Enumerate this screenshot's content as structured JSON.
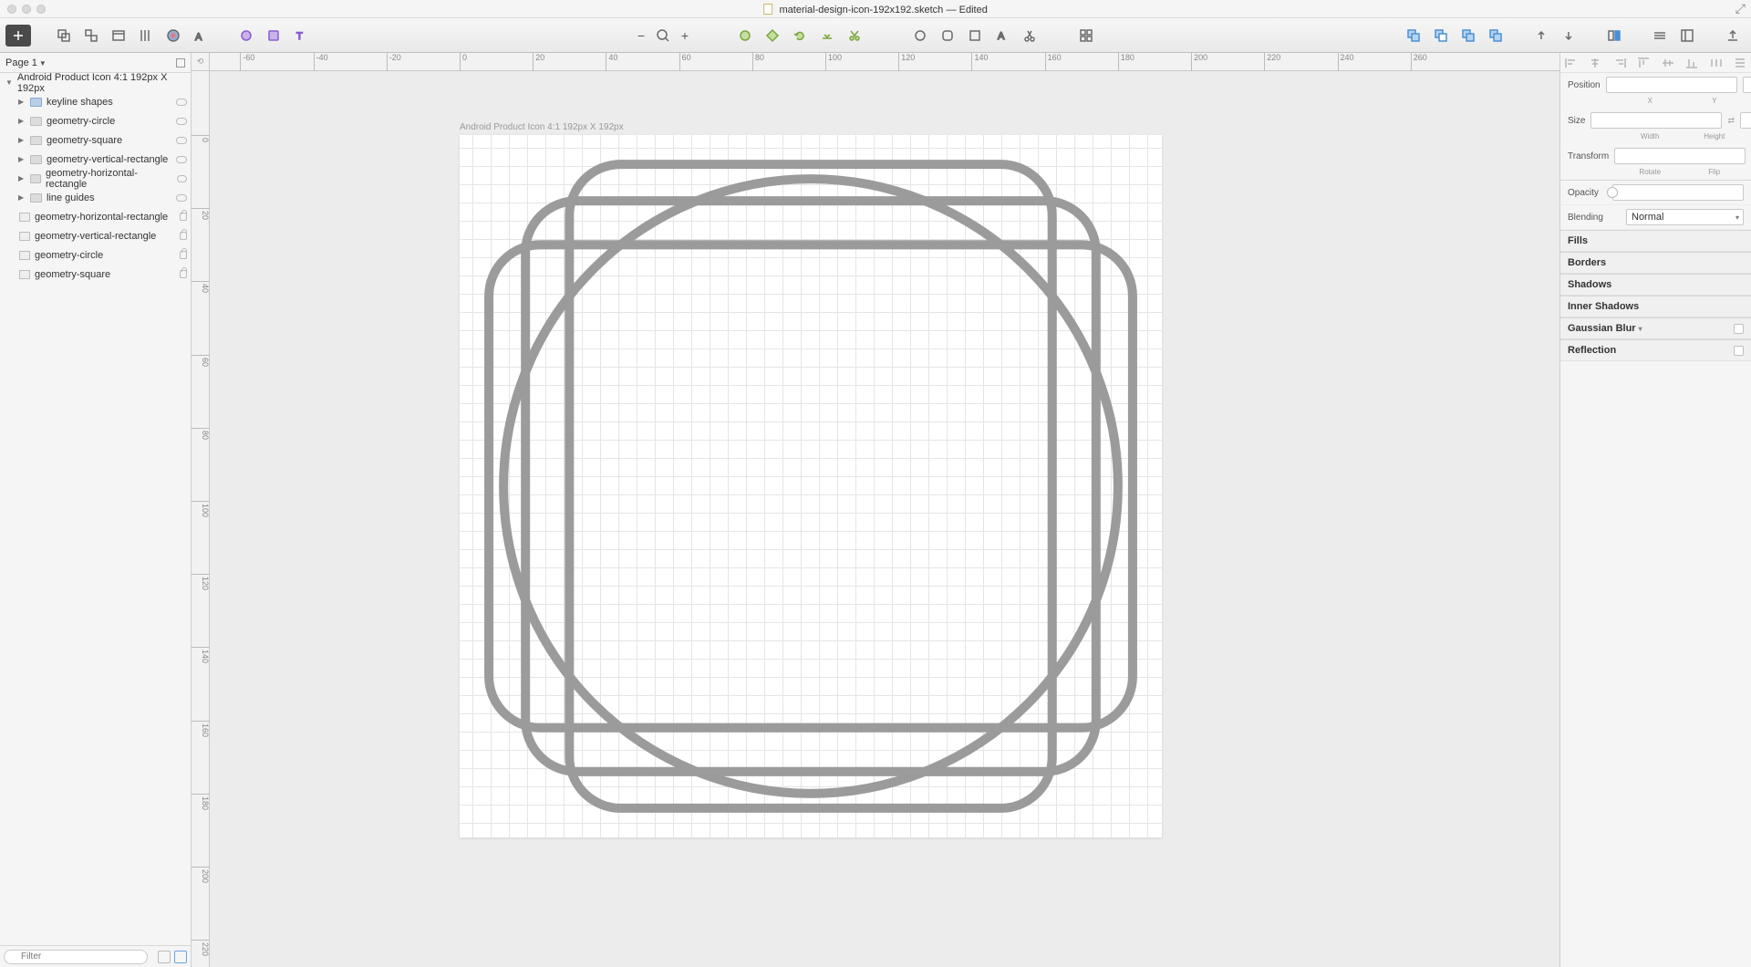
{
  "title": {
    "filename": "material-design-icon-192x192.sketch",
    "status": "— Edited"
  },
  "pages": {
    "label": "Page 1"
  },
  "layers": {
    "artboard": "Android Product Icon 4:1 192px X 192px",
    "items": [
      {
        "label": "keyline shapes",
        "dim": false,
        "folder": "blue",
        "icon": "eye"
      },
      {
        "label": "geometry-circle",
        "dim": true,
        "folder": "gray",
        "icon": "eye"
      },
      {
        "label": "geometry-square",
        "dim": true,
        "folder": "gray",
        "icon": "eye"
      },
      {
        "label": "geometry-vertical-rectangle",
        "dim": true,
        "folder": "gray",
        "icon": "eye"
      },
      {
        "label": "geometry-horizontal-rectangle",
        "dim": true,
        "folder": "gray",
        "icon": "eye"
      },
      {
        "label": "line guides",
        "dim": true,
        "folder": "gray",
        "icon": "eye"
      }
    ],
    "shapes": [
      {
        "label": "geometry-horizontal-rectangle"
      },
      {
        "label": "geometry-vertical-rectangle"
      },
      {
        "label": "geometry-circle"
      },
      {
        "label": "geometry-square"
      }
    ]
  },
  "filter_placeholder": "Filter",
  "canvas": {
    "artboard_label": "Android Product Icon 4:1 192px X 192px",
    "ruler_h": [
      -60,
      -40,
      -20,
      0,
      20,
      40,
      60,
      80,
      100,
      120,
      140,
      160,
      180,
      200,
      220,
      240,
      260
    ],
    "ruler_v": [
      0,
      20,
      40,
      60,
      80,
      100,
      120,
      140,
      160,
      180,
      200,
      220
    ]
  },
  "inspector": {
    "position": "Position",
    "x": "X",
    "y": "Y",
    "size": "Size",
    "width": "Width",
    "height": "Height",
    "lock_glyph": "⟘",
    "transform": "Transform",
    "rotate": "Rotate",
    "flip": "Flip",
    "opacity": "Opacity",
    "blending": "Blending",
    "blending_value": "Normal",
    "sections": [
      "Fills",
      "Borders",
      "Shadows",
      "Inner Shadows",
      "Gaussian Blur",
      "Reflection"
    ]
  }
}
